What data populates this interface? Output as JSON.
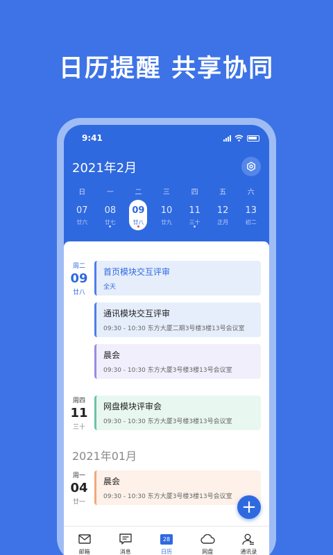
{
  "headline": "日历提醒 共享协同",
  "status": {
    "time": "9:41"
  },
  "calendar": {
    "month_title": "2021年2月",
    "weekdays": [
      "日",
      "一",
      "二",
      "三",
      "四",
      "五",
      "六"
    ],
    "dates": [
      {
        "num": "07",
        "lunar": "廿六",
        "dot": false,
        "selected": false
      },
      {
        "num": "08",
        "lunar": "廿七",
        "dot": true,
        "selected": false
      },
      {
        "num": "09",
        "lunar": "廿八",
        "dot": true,
        "selected": true
      },
      {
        "num": "10",
        "lunar": "廿九",
        "dot": false,
        "selected": false
      },
      {
        "num": "11",
        "lunar": "三十",
        "dot": true,
        "selected": false
      },
      {
        "num": "12",
        "lunar": "正月",
        "dot": false,
        "selected": false
      },
      {
        "num": "13",
        "lunar": "初二",
        "dot": false,
        "selected": false
      }
    ]
  },
  "days": [
    {
      "weekday": "周二",
      "day": "09",
      "lunar": "廿八",
      "events": [
        {
          "title": "首页模块交互评审",
          "detail": "全天"
        },
        {
          "title": "通讯模块交互评审",
          "detail": "09:30 - 10:30   东方大厦二期3号楼3楼13号会议室"
        },
        {
          "title": "晨会",
          "detail": "09:30 - 10:30   东方大厦3号楼3楼13号会议室"
        }
      ]
    },
    {
      "weekday": "周四",
      "day": "11",
      "lunar": "三十",
      "events": [
        {
          "title": "网盘模块评审会",
          "detail": "09:30 - 10:30   东方大厦3号楼3楼13号会议室"
        }
      ]
    },
    {
      "weekday": "周一",
      "day": "04",
      "lunar": "廿一",
      "events": [
        {
          "title": "晨会",
          "detail": "09:30 - 10:30   东方大厦3号楼3楼13号会议室"
        }
      ]
    }
  ],
  "month_separator": "2021年01月",
  "fab_label": "+",
  "tabs": [
    {
      "label": "邮箱",
      "icon": "mail-icon"
    },
    {
      "label": "消息",
      "icon": "message-icon"
    },
    {
      "label": "日历",
      "icon": "calendar-icon",
      "badge": "28",
      "active": true
    },
    {
      "label": "网盘",
      "icon": "cloud-icon"
    },
    {
      "label": "通讯录",
      "icon": "contacts-icon"
    }
  ],
  "colors": {
    "primary": "#2f69df",
    "background": "#3d73e6"
  }
}
